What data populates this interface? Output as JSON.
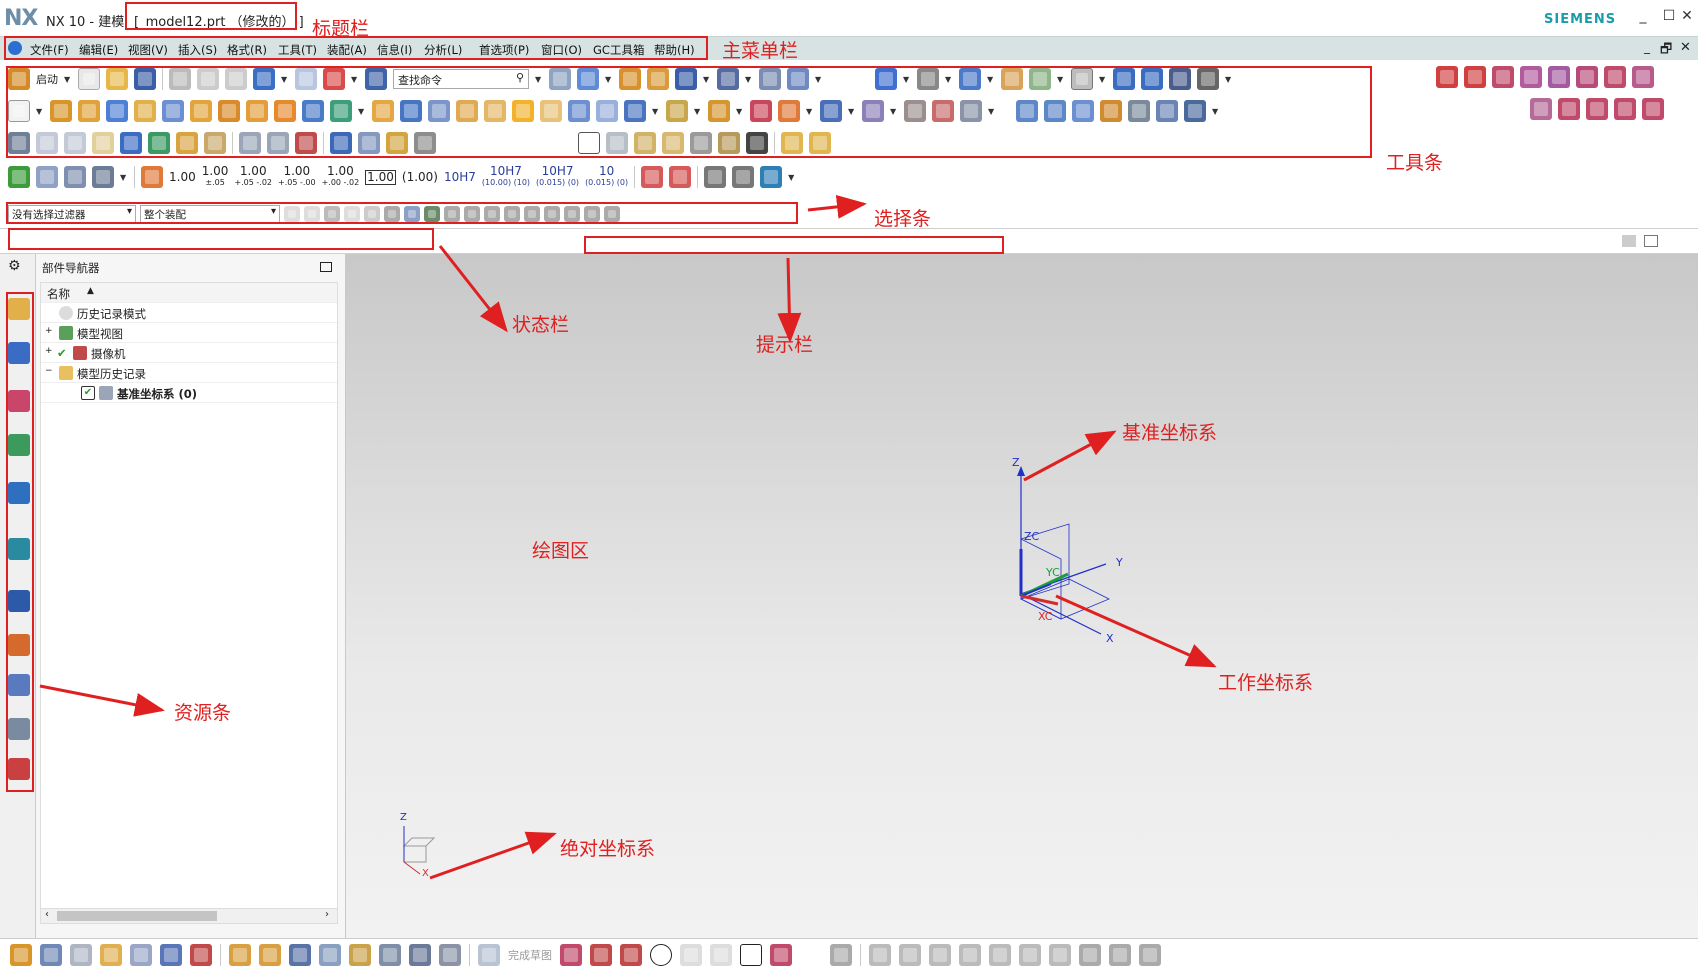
{
  "window": {
    "app_title": "NX 10 - 建模",
    "file_title": "[_model12.prt （修改的） ]",
    "brand": "SIEMENS",
    "min_symbol": "_",
    "max_symbol": "☐",
    "close_symbol": "✕"
  },
  "menubar": {
    "items": [
      "文件(F)",
      "编辑(E)",
      "视图(V)",
      "插入(S)",
      "格式(R)",
      "工具(T)",
      "装配(A)",
      "信息(I)",
      "分析(L)",
      "首选项(P)",
      "窗口(O)",
      "GC工具箱",
      "帮助(H)"
    ],
    "restore_symbol": "🗗",
    "close_symbol": "✕"
  },
  "toolbar": {
    "start_label": "启动",
    "command_finder_placeholder": "查找命令",
    "dimension_values": [
      {
        "main": "1.00",
        "sub": ""
      },
      {
        "main": "1.00",
        "sub": "±.05"
      },
      {
        "main": "1.00",
        "sub": "+.05 -.02"
      },
      {
        "main": "1.00",
        "sub": "+.05 -.00"
      },
      {
        "main": "1.00",
        "sub": "+.00 -.02"
      },
      {
        "main": "1.00",
        "sub": ""
      },
      {
        "main": "(1.00)",
        "sub": ""
      },
      {
        "main": "10H7",
        "sub": ""
      },
      {
        "main": "10H7",
        "sub": "(10.00) (10)"
      },
      {
        "main": "10H7",
        "sub": "(0.015) (0)"
      },
      {
        "main": "10",
        "sub": "(0.015) (0)"
      }
    ],
    "finish_sketch_label": "完成草图"
  },
  "selection_bar": {
    "filter_value": "没有选择过滤器",
    "scope_value": "整个装配"
  },
  "navigator": {
    "title": "部件导航器",
    "column_header": "名称",
    "sort_symbol": "▲",
    "items": [
      {
        "label": "历史记录模式",
        "icon": "clock-icon"
      },
      {
        "label": "模型视图",
        "icon": "model-views-icon"
      },
      {
        "label": "摄像机",
        "icon": "camera-icon"
      },
      {
        "label": "模型历史记录",
        "icon": "folder-icon"
      },
      {
        "label": "基准坐标系 (0)",
        "icon": "datum-csys-icon"
      }
    ]
  },
  "graphics": {
    "datum_axes": {
      "z": "Z",
      "y": "Y",
      "x": "X"
    },
    "wcs_axes": {
      "zc": "ZC",
      "yc": "YC",
      "xc": "XC"
    },
    "abs_axes": {
      "z": "Z",
      "x": "X"
    }
  },
  "annotations": {
    "title_bar": "标题栏",
    "main_menu": "主菜单栏",
    "toolbar": "工具条",
    "selection_bar": "选择条",
    "status_bar": "状态栏",
    "cue_line": "提示栏",
    "resource_bar": "资源条",
    "graphics_area": "绘图区",
    "datum_csys": "基准坐标系",
    "work_csys": "工作坐标系",
    "absolute_csys": "绝对坐标系"
  },
  "colors": {
    "annotation_red": "#e02020",
    "menubar_bg": "#d7e3e3",
    "brand_teal": "#1a9da6",
    "axis_blue": "#2130c8",
    "wcs_green": "#1e9e3a"
  }
}
